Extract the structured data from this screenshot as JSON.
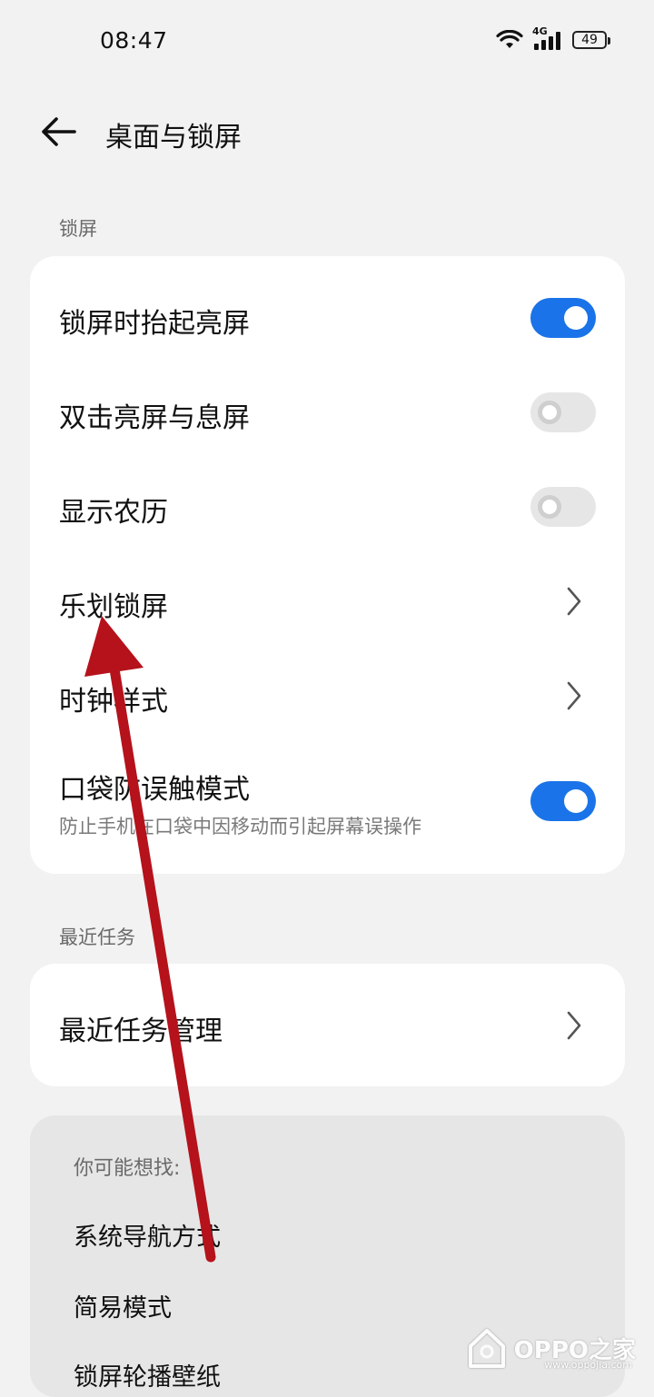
{
  "status_bar": {
    "time": "08:47",
    "network": "4G",
    "battery": "49"
  },
  "header": {
    "title": "桌面与锁屏"
  },
  "lock_section": {
    "label": "锁屏",
    "items": [
      {
        "label": "锁屏时抬起亮屏",
        "type": "toggle",
        "state": "on"
      },
      {
        "label": "双击亮屏与息屏",
        "type": "toggle",
        "state": "off"
      },
      {
        "label": "显示农历",
        "type": "toggle",
        "state": "off"
      },
      {
        "label": "乐划锁屏",
        "type": "link"
      },
      {
        "label": "时钟样式",
        "type": "link"
      },
      {
        "label": "口袋防误触模式",
        "sub": "防止手机在口袋中因移动而引起屏幕误操作",
        "type": "toggle",
        "state": "on"
      }
    ]
  },
  "recent_section": {
    "label": "最近任务",
    "items": [
      {
        "label": "最近任务管理",
        "type": "link"
      }
    ]
  },
  "suggestions": {
    "title": "你可能想找:",
    "items": [
      "系统导航方式",
      "简易模式",
      "锁屏轮播壁纸"
    ]
  },
  "watermark": {
    "brand": "OPPO之家",
    "url": "www.oppojia.com"
  },
  "colors": {
    "accent": "#1a73e8",
    "annotation_arrow": "#b5121b"
  }
}
